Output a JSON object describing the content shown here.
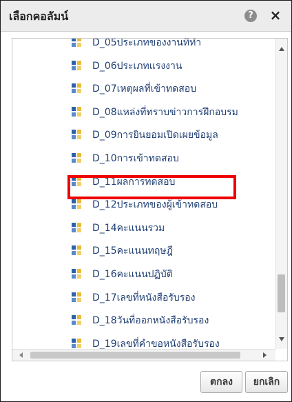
{
  "dialog": {
    "title": "เลือกคอลัมน์",
    "help_icon": "question-icon",
    "help_glyph": "?",
    "close_icon": "close-icon",
    "close_glyph": "×"
  },
  "list": {
    "items": [
      {
        "label": "D_05ประเภทของงานที่ทำ",
        "icon": "column-icon"
      },
      {
        "label": "D_06ประเภทแรงงาน",
        "icon": "column-icon"
      },
      {
        "label": "D_07เหตุผลที่เข้าทดสอบ",
        "icon": "column-icon"
      },
      {
        "label": "D_08แหล่งที่ทราบข่าวการฝึกอบรม",
        "icon": "column-icon"
      },
      {
        "label": "D_09การยินยอมเปิดเผยข้อมูล",
        "icon": "column-icon"
      },
      {
        "label": "D_10การเข้าทดสอบ",
        "icon": "column-icon"
      },
      {
        "label": "D_11ผลการทดสอบ",
        "icon": "column-icon",
        "highlighted": true
      },
      {
        "label": "D_12ประเภทของผู้เข้าทดสอบ",
        "icon": "column-icon"
      },
      {
        "label": "D_14คะแนนรวม",
        "icon": "column-icon"
      },
      {
        "label": "D_15คะแนนทฤษฎี",
        "icon": "column-icon"
      },
      {
        "label": "D_16คะแนนปฏิบัติ",
        "icon": "column-icon"
      },
      {
        "label": "D_17เลขที่หนังสือรับรอง",
        "icon": "column-icon"
      },
      {
        "label": "D_18วันที่ออกหนังสือรับรอง",
        "icon": "column-icon"
      },
      {
        "label": "D_19เลขที่คำขอหนังสือรับรอง",
        "icon": "column-icon"
      }
    ]
  },
  "buttons": {
    "ok_label": "ตกลง",
    "cancel_label": "ยกเลิก"
  },
  "colors": {
    "highlight": "#ee0000",
    "item_text": "#1f3f73"
  }
}
